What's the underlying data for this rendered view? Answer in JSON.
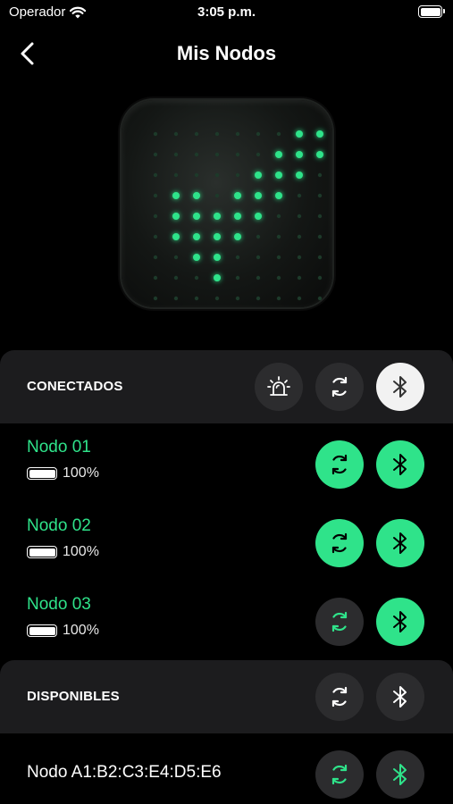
{
  "status_bar": {
    "carrier": "Operador",
    "time": "3:05 p.m.",
    "battery_level": 1.0
  },
  "nav": {
    "title": "Mis Nodos",
    "back_icon": "chevron-left-icon"
  },
  "device_preview": {
    "description_icon": "led-matrix-check-icon",
    "led_on_color": "#2fe38a",
    "led_off_color": "#1d3a2a"
  },
  "colors": {
    "accent": "#2fe38a",
    "surface": "#1c1c1e",
    "button_dark": "#2c2c2e"
  },
  "connected": {
    "label": "CONECTADOS",
    "actions": [
      {
        "icon": "alarm-light-icon",
        "style": "dark"
      },
      {
        "icon": "sync-icon",
        "style": "dark"
      },
      {
        "icon": "bluetooth-icon",
        "style": "white"
      }
    ],
    "nodes": [
      {
        "name": "Nodo 01",
        "battery": "100%",
        "sync_style": "green",
        "bt_style": "green"
      },
      {
        "name": "Nodo 02",
        "battery": "100%",
        "sync_style": "green",
        "bt_style": "green"
      },
      {
        "name": "Nodo 03",
        "battery": "100%",
        "sync_style": "dark",
        "bt_style": "green"
      }
    ]
  },
  "available": {
    "label": "DISPONIBLES",
    "actions": [
      {
        "icon": "sync-icon",
        "style": "dark"
      },
      {
        "icon": "bluetooth-icon",
        "style": "dark"
      }
    ],
    "devices": [
      {
        "name": "Nodo A1:B2:C3:E4:D5:E6",
        "sync_style": "dark",
        "bt_style": "dark"
      }
    ]
  }
}
